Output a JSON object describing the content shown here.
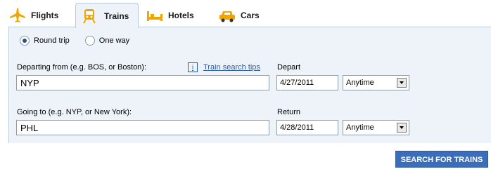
{
  "tabs": [
    {
      "label": "Flights",
      "icon": "airplane-icon"
    },
    {
      "label": "Trains",
      "icon": "train-icon"
    },
    {
      "label": "Hotels",
      "icon": "bed-icon"
    },
    {
      "label": "Cars",
      "icon": "car-icon"
    }
  ],
  "trip_type": {
    "options": [
      {
        "label": "Round trip",
        "selected": true
      },
      {
        "label": "One way",
        "selected": false
      }
    ]
  },
  "form": {
    "departing_label": "Departing from (e.g. BOS, or Boston):",
    "departing_value": "NYP",
    "tips_label": "Train search tips",
    "depart_label": "Depart",
    "depart_date": "4/27/2011",
    "depart_time": "Anytime",
    "going_label": "Going to (e.g. NYP, or New York):",
    "going_value": "PHL",
    "return_label": "Return",
    "return_date": "4/28/2011",
    "return_time": "Anytime",
    "search_label": "SEARCH FOR TRAINS"
  },
  "colors": {
    "accent": "#f0a500",
    "link": "#2e5ca8",
    "panel": "#eef3f9",
    "button": "#3a6eb8"
  }
}
